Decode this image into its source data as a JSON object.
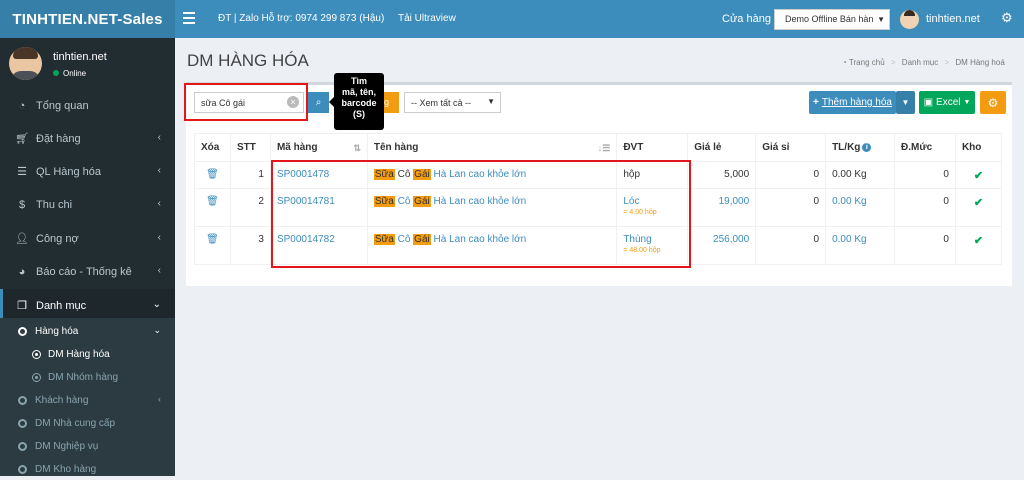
{
  "app": {
    "logo": "TINHTIEN.NET-Sales"
  },
  "topbar": {
    "support": "ĐT | Zalo Hỗ trợ: 0974 299 873 (Hậu)",
    "ultraview": "Tải Ultraview",
    "store_label": "Cửa hàng",
    "store_value": "Demo Offline Bán hàn",
    "username": "tinhtien.net"
  },
  "sidebar": {
    "user": {
      "name": "tinhtien.net",
      "status": "Online"
    },
    "items": [
      {
        "label": "Tổng quan",
        "icon": "dashboard-icon"
      },
      {
        "label": "Đặt hàng",
        "icon": "cart-icon"
      },
      {
        "label": "QL Hàng hóa",
        "icon": "list-icon"
      },
      {
        "label": "Thu chi",
        "icon": "dollar-icon"
      },
      {
        "label": "Công nợ",
        "icon": "user-icon"
      },
      {
        "label": "Báo cáo - Thống kê",
        "icon": "pie-chart-icon"
      },
      {
        "label": "Danh mục",
        "icon": "copy-icon"
      }
    ],
    "sub": {
      "hang_hoa": "Hàng hóa",
      "dm_hang_hoa": "DM Hàng hóa",
      "dm_nhom_hang": "DM Nhóm hàng",
      "khach_hang": "Khách hàng",
      "dm_nha_cung_cap": "DM Nhà cung cấp",
      "dm_nghiep_vu": "DM Nghiệp vụ",
      "dm_kho_hang": "DM Kho hàng"
    }
  },
  "page": {
    "title": "DM HÀNG HÓA",
    "breadcrumb": [
      "Trang chủ",
      "Danh mục",
      "DM Hàng hoá"
    ]
  },
  "toolbar": {
    "search_value": "sữa Cô gái",
    "tooltip_line1": "Tìm",
    "tooltip_line2": "mã, tên,",
    "tooltip_line3": "barcode",
    "tooltip_line4": "(S)",
    "chip": "g",
    "filter_value": "-- Xem tất cả --",
    "add_label": "Thêm hàng hóa",
    "excel_label": "Excel"
  },
  "table": {
    "headers": [
      "Xóa",
      "STT",
      "Mã hàng",
      "Tên hàng",
      "ĐVT",
      "Giá lẻ",
      "Giá sỉ",
      "TL/Kg",
      "Đ.Mức",
      "Kho"
    ],
    "rows": [
      {
        "stt": "1",
        "ma": "SP0001478",
        "ten_hl1": "Sữa",
        "ten_mid": "Cô",
        "ten_hl2": "Gái",
        "ten_rest": "Hà Lan cao khỏe lớn",
        "dvt": "hộp",
        "dvt_sub": "",
        "gia_le": "5,000",
        "gia_si": "0",
        "tl": "0.00 Kg",
        "dmuc": "0"
      },
      {
        "stt": "2",
        "ma": "SP00014781",
        "ten_hl1": "Sữa",
        "ten_mid": "Cô",
        "ten_hl2": "Gái",
        "ten_rest": "Hà Lan cao khỏe lớn",
        "dvt": "Lóc",
        "dvt_sub": "= 4.00 hộp",
        "gia_le": "19,000",
        "gia_si": "0",
        "tl": "0.00 Kg",
        "dmuc": "0"
      },
      {
        "stt": "3",
        "ma": "SP00014782",
        "ten_hl1": "Sữa",
        "ten_mid": "Cô",
        "ten_hl2": "Gái",
        "ten_rest": "Hà Lan cao khỏe lớn",
        "dvt": "Thùng",
        "dvt_sub": "= 48.00 hộp",
        "gia_le": "256,000",
        "gia_si": "0",
        "tl": "0.00 Kg",
        "dmuc": "0"
      }
    ]
  },
  "colors": {
    "header": "#3c8dbc",
    "sidebar": "#222d32",
    "highlight": "#f39c12",
    "annotation": "#e3161c",
    "success": "#00a65a"
  }
}
